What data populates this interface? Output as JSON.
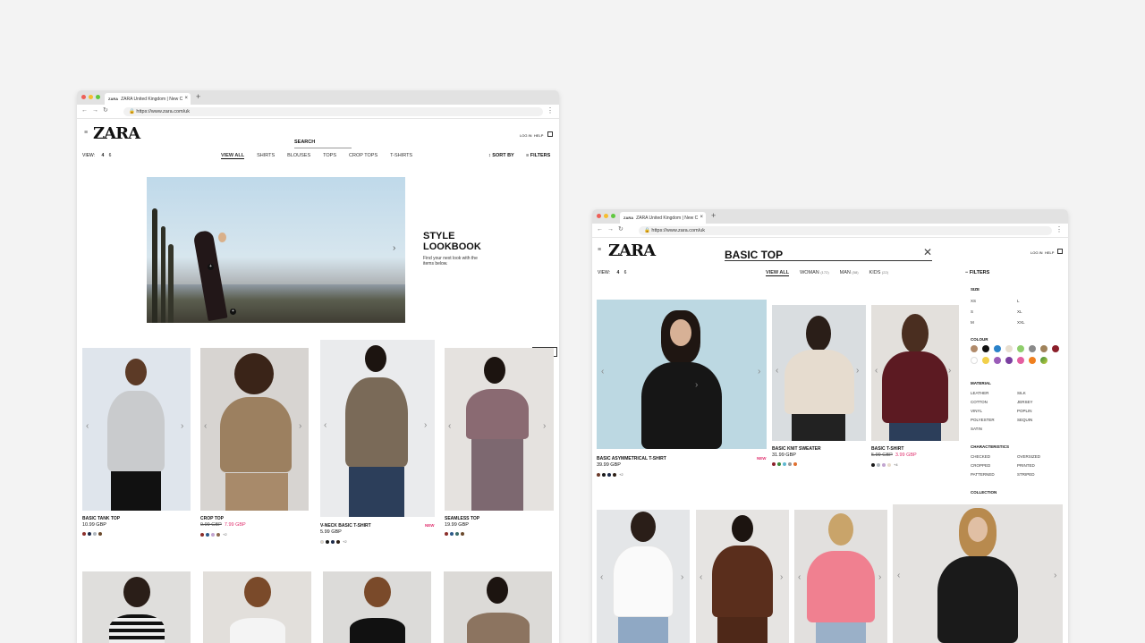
{
  "left_window": {
    "tab_title": "ZARA United Kingdom | New C",
    "tab_icon": "ZARA",
    "url": "https://www.zara.com/uk",
    "logo": "ZARA",
    "search_label": "SEARCH",
    "login": "LOG IN",
    "help": "HELP",
    "view_label": "VIEW:",
    "view_options": [
      "4",
      "6"
    ],
    "categories": [
      "VIEW ALL",
      "SHIRTS",
      "BLOUSES",
      "TOPS",
      "CROP TOPS",
      "T-SHIRTS"
    ],
    "sort_by": "SORT BY",
    "filters": "FILTERS",
    "lookbook_title_1": "STYLE",
    "lookbook_title_2": "LOOKBOOK",
    "lookbook_sub": "Find your next look with the items below.",
    "chat_label": "CHAT",
    "products": [
      {
        "name": "BASIC TANK TOP",
        "price": "10.99 GBP",
        "old_price": "",
        "sale_price": "",
        "new": "",
        "colors": [
          "#8b2e2a",
          "#1d2b4a",
          "#b0b7bf",
          "#6b4a2c"
        ],
        "more": ""
      },
      {
        "name": "CROP TOP",
        "price": "",
        "old_price": "9.99 GBP",
        "sale_price": "7.99 GBP",
        "new": "",
        "colors": [
          "#8b2e2a",
          "#2d5a8a",
          "#c2a5d0",
          "#8c6a50"
        ],
        "more": "+2"
      },
      {
        "name": "V-NECK BASIC T-SHIRT",
        "price": "5.99 GBP",
        "old_price": "",
        "sale_price": "",
        "new": "NEW",
        "colors": [
          "#e8dccb",
          "#1a1a1a",
          "#1d2b4a",
          "#2e2016"
        ],
        "more": "+2"
      },
      {
        "name": "SEAMLESS TOP",
        "price": "19.99 GBP",
        "old_price": "",
        "sale_price": "",
        "new": "",
        "colors": [
          "#8b2e2a",
          "#2d5a8a",
          "#3c6d6a",
          "#6b4a2c"
        ],
        "more": ""
      }
    ]
  },
  "right_window": {
    "tab_title": "ZARA United Kingdom | New C",
    "tab_icon": "ZARA",
    "url": "https://www.zara.com/uk",
    "logo": "ZARA",
    "search_query": "BASIC TOP",
    "login": "LOG IN",
    "help": "HELP",
    "view_label": "VIEW:",
    "view_options": [
      "4",
      "6"
    ],
    "categories": [
      "VIEW ALL",
      "WOMAN",
      "MAN",
      "KIDS"
    ],
    "category_counts": [
      "",
      "(172)",
      "(58)",
      "(22)"
    ],
    "filters": "FILTERS",
    "filter_size_title": "SIZE",
    "sizes_col1": [
      "XS",
      "S",
      "M"
    ],
    "sizes_col2": [
      "L",
      "XL",
      "XXL"
    ],
    "filter_colour_title": "COLOUR",
    "colour_swatches": [
      "#b08a6a",
      "#111111",
      "#2a82c9",
      "#e8dfd0",
      "#8fce6c",
      "#8a8a8a",
      "#a0825a",
      "#8b1f2a",
      "#ffffff",
      "#f2d04a",
      "#9a5cb8",
      "#7a3fa0",
      "#e45ea0",
      "#f08020",
      "#3a8a3a"
    ],
    "filter_material_title": "MATERIAL",
    "materials_col1": [
      "LEATHER",
      "COTTON",
      "VINYL",
      "POLYESTER",
      "SATIN"
    ],
    "materials_col2": [
      "SILK",
      "JERSEY",
      "POPLIN",
      "SEQUIN"
    ],
    "filter_char_title": "CHARACTERISTICS",
    "chars_col1": [
      "CHECKED",
      "CROPPED",
      "PATTERNED"
    ],
    "chars_col2": [
      "OVERSIZED",
      "PRINTED",
      "STRIPED"
    ],
    "filter_collection_title": "COLLECTION",
    "products": [
      {
        "name": "BASIC ASYMMETRICAL T-SHIRT",
        "price": "39.99 GBP",
        "old_price": "",
        "sale_price": "",
        "new": "NEW",
        "colors": [
          "#6b3a2a",
          "#1a1a1a",
          "#1d2b4a",
          "#2e2016"
        ],
        "more": "+2"
      },
      {
        "name": "BASIC KNIT SWEATER",
        "price": "31.99 GBP",
        "old_price": "",
        "sale_price": "",
        "new": "",
        "colors": [
          "#8b1f2a",
          "#3a8a3a",
          "#5fb8d0",
          "#9a9a9a",
          "#e07030"
        ],
        "more": ""
      },
      {
        "name": "BASIC T-SHIRT",
        "price": "",
        "old_price": "5.99 GBP",
        "sale_price": "3.99 GBP",
        "new": "",
        "colors": [
          "#1a1a1a",
          "#b0b7bf",
          "#c2a5d0",
          "#e8dccb"
        ],
        "more": "+4"
      }
    ]
  }
}
